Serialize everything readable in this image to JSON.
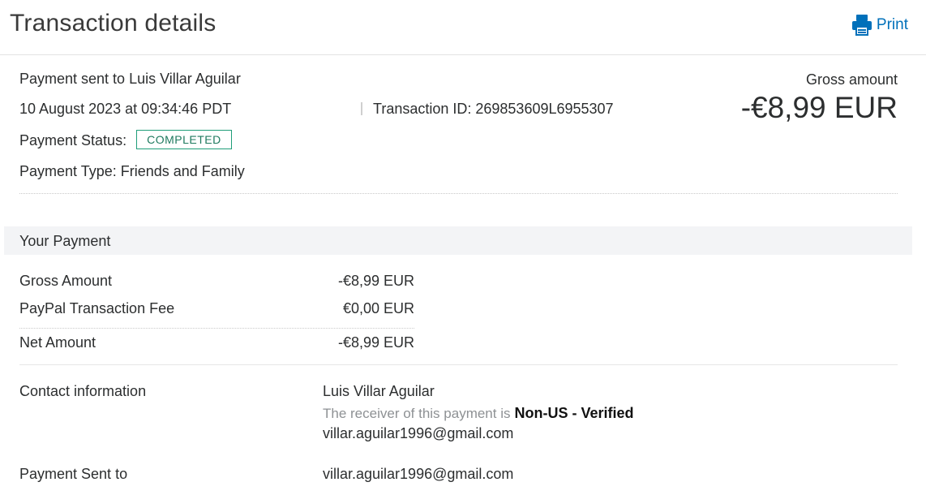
{
  "header": {
    "title": "Transaction details",
    "print_label": "Print",
    "print_icon": "printer-icon",
    "accent_color": "#0070ba"
  },
  "summary": {
    "recipient_line": "Payment sent to Luis Villar Aguilar",
    "datetime": "10 August 2023 at 09:34:46 PDT",
    "transaction_id": "Transaction ID: 269853609L6955307",
    "status_label": "Payment Status:",
    "status_value": "COMPLETED",
    "status_color": "#1f9d79",
    "type_line": "Payment Type: Friends and Family",
    "gross_label": "Gross amount",
    "gross_value": "-€8,99 EUR"
  },
  "your_payment": {
    "section_title": "Your Payment",
    "rows": [
      {
        "label": "Gross Amount",
        "value": "-€8,99 EUR"
      },
      {
        "label": "PayPal Transaction Fee",
        "value": "€0,00 EUR"
      },
      {
        "label": "Net Amount",
        "value": "-€8,99 EUR"
      }
    ]
  },
  "contact": {
    "label": "Contact information",
    "name": "Luis Villar Aguilar",
    "receiver_note_prefix": "The receiver of this payment is",
    "receiver_note_status": "Non-US - Verified",
    "email": "villar.aguilar1996@gmail.com"
  },
  "sent_to": {
    "label": "Payment Sent to",
    "email": "villar.aguilar1996@gmail.com"
  }
}
